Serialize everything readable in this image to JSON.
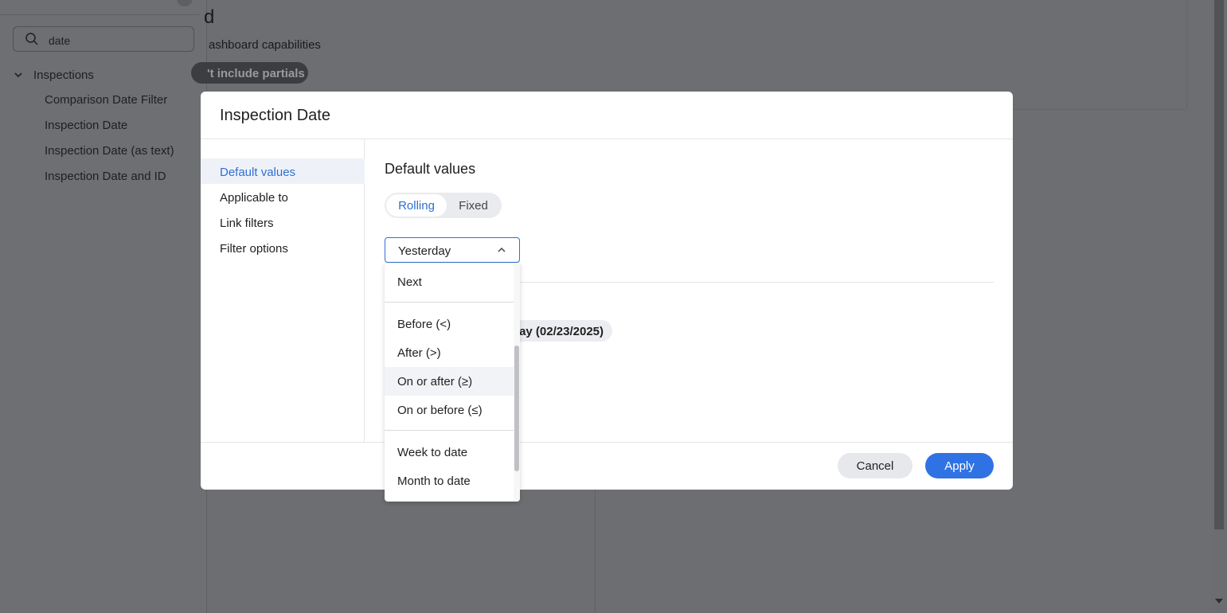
{
  "sidebar": {
    "search": {
      "value": "date"
    },
    "tree": {
      "group_label": "Inspections",
      "items": [
        {
          "label": "Comparison Date Filter"
        },
        {
          "label": "Inspection Date"
        },
        {
          "label": "Inspection Date (as text)"
        },
        {
          "label": "Inspection Date and ID"
        }
      ]
    }
  },
  "background": {
    "title_fragment": "d",
    "subtitle_fragment": "ashboard capabilities",
    "pill_label": "'t include partials"
  },
  "modal": {
    "title": "Inspection Date",
    "nav": [
      {
        "label": "Default values",
        "active": true
      },
      {
        "label": "Applicable to",
        "active": false
      },
      {
        "label": "Link filters",
        "active": false
      },
      {
        "label": "Filter options",
        "active": false
      }
    ],
    "section_title": "Default values",
    "toggle": {
      "options": [
        "Rolling",
        "Fixed"
      ],
      "selected": "Rolling"
    },
    "select": {
      "value": "Yesterday",
      "options": [
        {
          "label": "Next"
        },
        {
          "label": "Before (<)"
        },
        {
          "label": "After (>)"
        },
        {
          "label": "On or after (≥)",
          "hovered": true
        },
        {
          "label": "On or before (≤)"
        },
        {
          "label": "Week to date"
        },
        {
          "label": "Month to date"
        }
      ]
    },
    "chip_label": "ay (02/23/2025)",
    "buttons": {
      "cancel": "Cancel",
      "apply": "Apply"
    }
  },
  "colors": {
    "accent": "#2f72e4",
    "active_nav_text": "#2f6fd0",
    "overlay": "#6d6e71"
  }
}
